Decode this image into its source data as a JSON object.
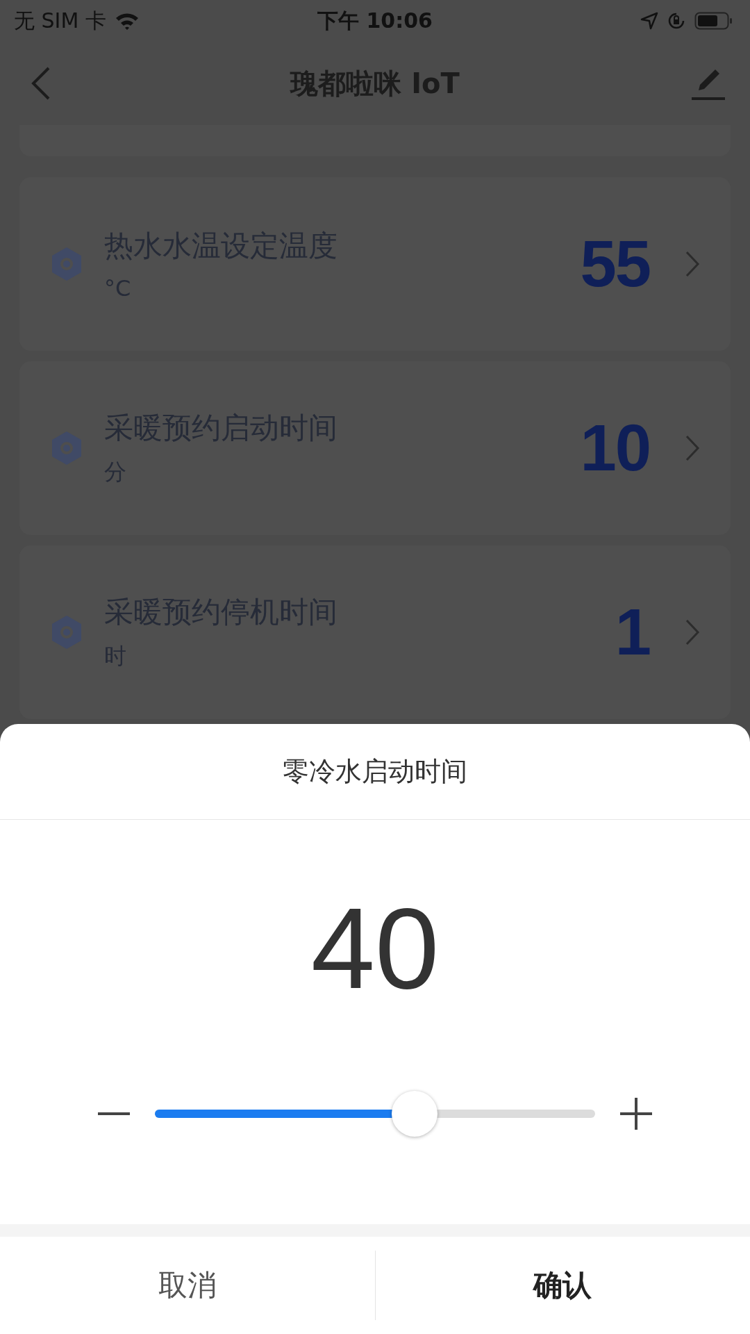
{
  "status_bar": {
    "carrier": "无 SIM 卡",
    "time": "下午 10:06"
  },
  "header": {
    "title": "瑰都啦咪 IoT"
  },
  "settings": [
    {
      "label": "热水水温设定温度",
      "unit": "°C",
      "value": "55"
    },
    {
      "label": "采暖预约启动时间",
      "unit": "分",
      "value": "10"
    },
    {
      "label": "采暖预约停机时间",
      "unit": "时",
      "value": "1"
    }
  ],
  "dialog": {
    "title": "零冷水启动时间",
    "value": "40",
    "slider": {
      "level": 0.59
    },
    "buttons": [
      {
        "label": "取消",
        "kind": "cancel"
      },
      {
        "label": "确认",
        "kind": "confirm"
      }
    ]
  }
}
